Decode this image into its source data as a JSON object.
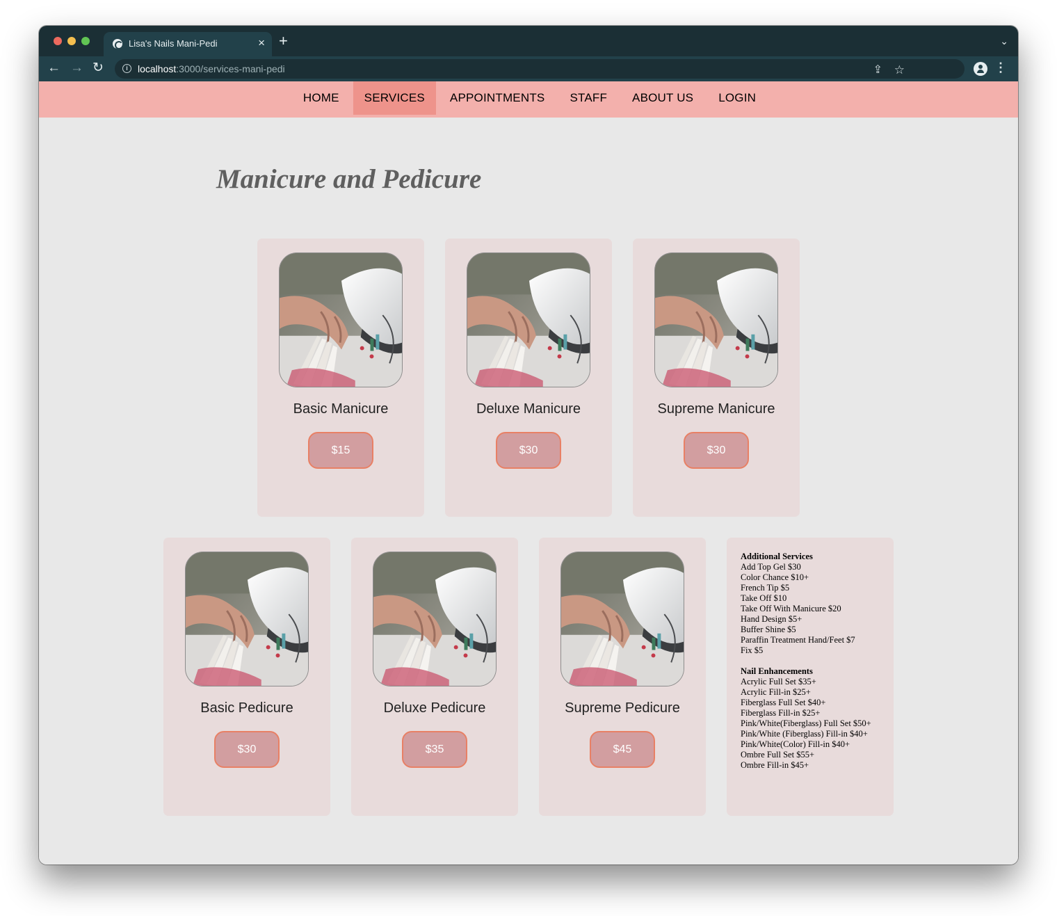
{
  "browser": {
    "tab_title": "Lisa's Nails Mani-Pedi",
    "url_host": "localhost",
    "url_path": ":3000/services-mani-pedi"
  },
  "nav": {
    "items": [
      {
        "label": "HOME",
        "active": false
      },
      {
        "label": "SERVICES",
        "active": true
      },
      {
        "label": "APPOINTMENTS",
        "active": false
      },
      {
        "label": "STAFF",
        "active": false
      },
      {
        "label": "ABOUT US",
        "active": false
      },
      {
        "label": "LOGIN",
        "active": false
      }
    ]
  },
  "page_title": "Manicure and Pedicure",
  "services": [
    {
      "name": "Basic Manicure",
      "price": "$15"
    },
    {
      "name": "Deluxe Manicure",
      "price": "$30"
    },
    {
      "name": "Supreme Manicure",
      "price": "$30"
    },
    {
      "name": "Basic Pedicure",
      "price": "$30"
    },
    {
      "name": "Deluxe Pedicure",
      "price": "$35"
    },
    {
      "name": "Supreme Pedicure",
      "price": "$45"
    }
  ],
  "additional_services": {
    "title": "Additional Services",
    "items": [
      "Add Top Gel $30",
      "Color Chance $10+",
      "French Tip $5",
      "Take Off $10",
      "Take Off With Manicure $20",
      "Hand Design $5+",
      "Buffer Shine $5",
      "Paraffin Treatment Hand/Feet $7",
      "Fix $5"
    ]
  },
  "nail_enhancements": {
    "title": "Nail Enhancements",
    "items": [
      "Acrylic Full Set $35+",
      "Acrylic Fill-in $25+",
      "Fiberglass Full Set $40+",
      "Fiberglass Fill-in $25+",
      "Pink/White(Fiberglass) Full Set $50+",
      "Pink/White (Fiberglass) Fill-in $40+",
      "Pink/White(Color) Fill-in $40+",
      "Ombre Full Set $55+",
      "Ombre Fill-in $45+"
    ]
  },
  "colors": {
    "nav_bg": "#f3b0ac",
    "nav_active": "#ee938b",
    "card_bg": "#e8dbdb",
    "price_button": "#d29ea0",
    "price_border": "#e88065"
  }
}
